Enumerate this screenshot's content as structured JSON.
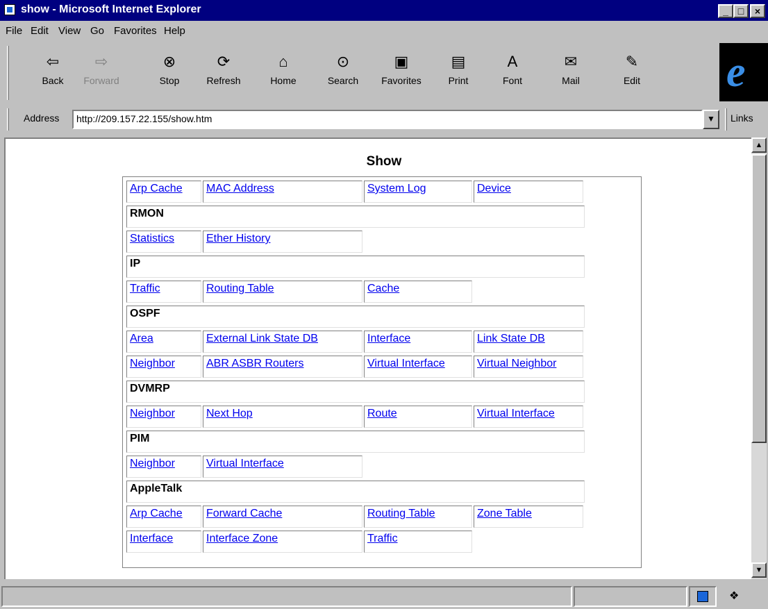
{
  "window": {
    "title": "show - Microsoft Internet Explorer"
  },
  "menu": [
    {
      "label": "File"
    },
    {
      "label": "Edit"
    },
    {
      "label": "View"
    },
    {
      "label": "Go"
    },
    {
      "label": "Favorites"
    },
    {
      "label": "Help"
    }
  ],
  "toolbar": {
    "back": "Back",
    "forward": "Forward",
    "stop": "Stop",
    "refresh": "Refresh",
    "home": "Home",
    "search": "Search",
    "favorites": "Favorites",
    "print": "Print",
    "font": "Font",
    "mail": "Mail",
    "edit": "Edit"
  },
  "address": {
    "label": "Address",
    "url": "http://209.157.22.155/show.htm",
    "links": "Links"
  },
  "page": {
    "title": "Show",
    "rows": [
      {
        "type": "links",
        "cells": [
          "Arp Cache",
          "MAC Address",
          "System Log",
          "Device"
        ]
      },
      {
        "type": "head",
        "text": "RMON"
      },
      {
        "type": "links",
        "cells": [
          "Statistics",
          "Ether History"
        ]
      },
      {
        "type": "head",
        "text": "IP"
      },
      {
        "type": "links",
        "cells": [
          "Traffic",
          "Routing Table",
          "Cache"
        ]
      },
      {
        "type": "head",
        "text": "OSPF"
      },
      {
        "type": "links",
        "cells": [
          "Area",
          "External Link State DB",
          "Interface",
          "Link State DB"
        ]
      },
      {
        "type": "links",
        "cells": [
          "Neighbor",
          "ABR ASBR Routers",
          "Virtual Interface",
          "Virtual Neighbor"
        ]
      },
      {
        "type": "head",
        "text": "DVMRP"
      },
      {
        "type": "links",
        "cells": [
          "Neighbor",
          "Next Hop",
          "Route",
          "Virtual Interface"
        ]
      },
      {
        "type": "head",
        "text": "PIM"
      },
      {
        "type": "links",
        "cells": [
          "Neighbor",
          "Virtual Interface"
        ]
      },
      {
        "type": "head",
        "text": "AppleTalk"
      },
      {
        "type": "links",
        "cells": [
          "Arp Cache",
          "Forward Cache",
          "Routing Table",
          "Zone Table"
        ]
      },
      {
        "type": "links",
        "cells": [
          "Interface",
          "Interface Zone",
          "Traffic"
        ]
      }
    ]
  },
  "colors": {
    "titlebar": "#000080",
    "chrome": "#c0c0c0",
    "link": "#0000ee"
  }
}
